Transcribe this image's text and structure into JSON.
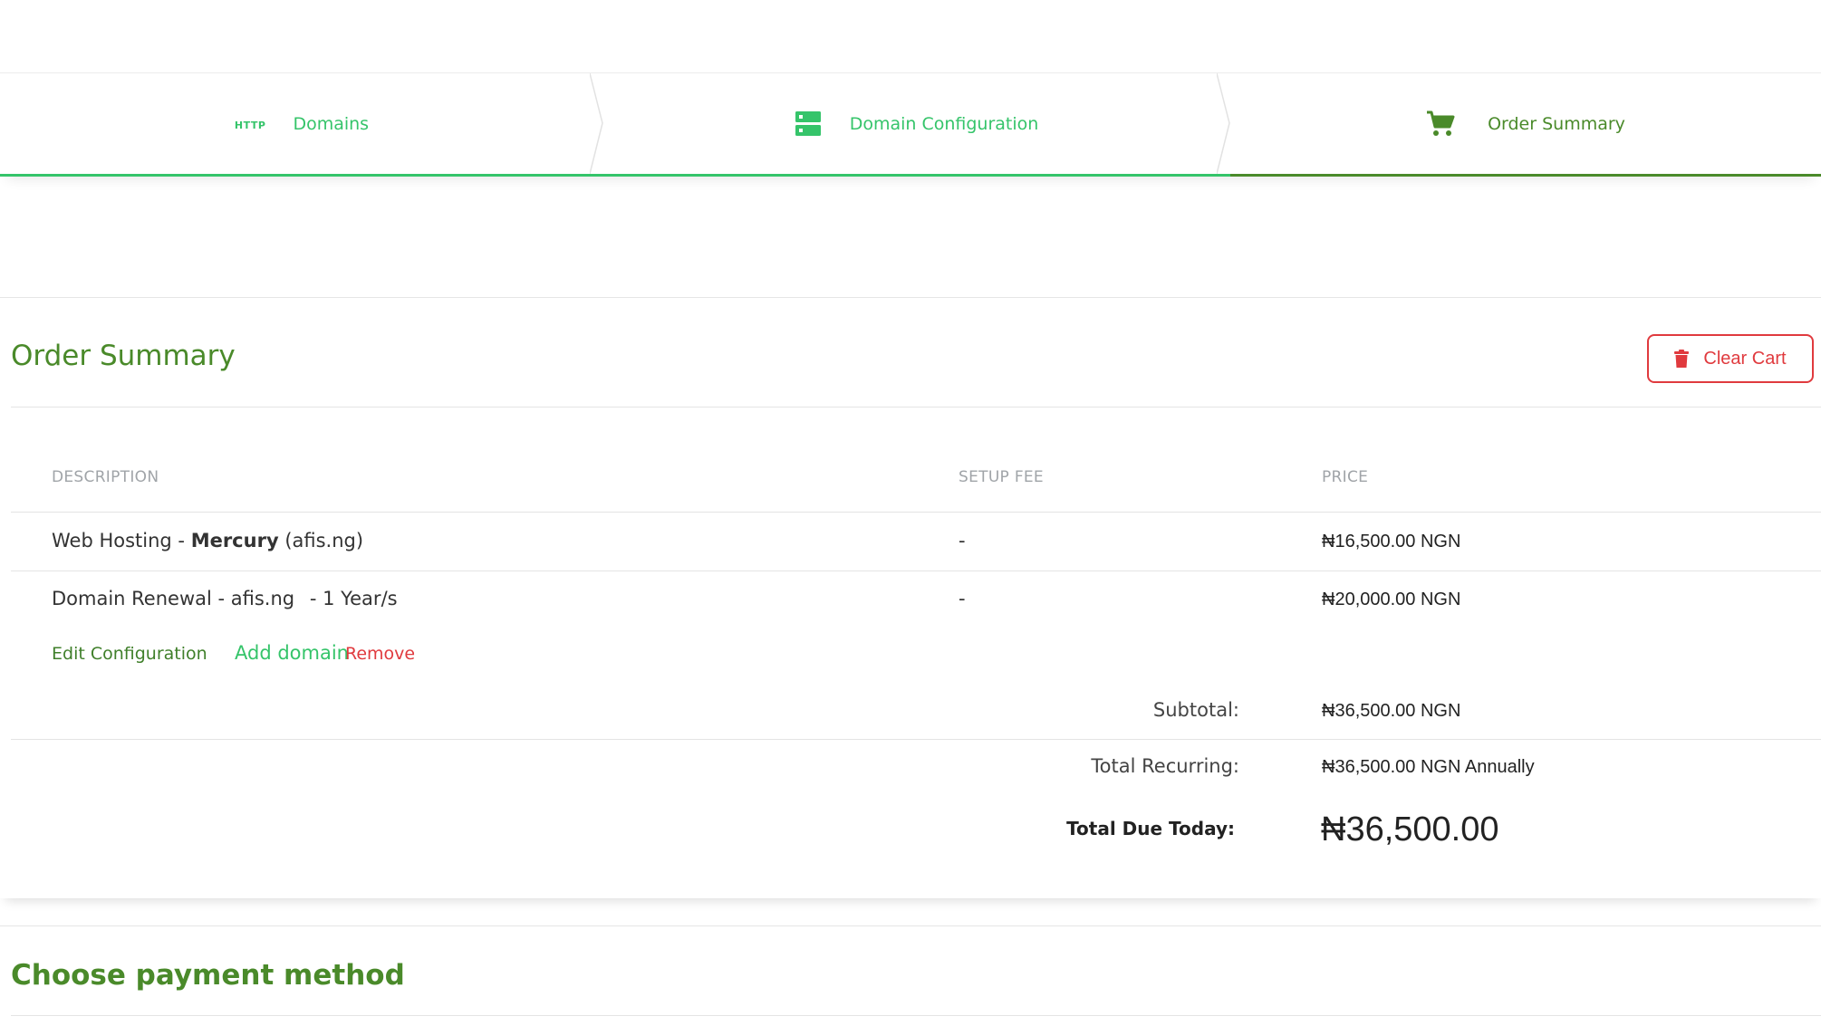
{
  "steps": [
    {
      "label": "Domains",
      "icon": "http-icon"
    },
    {
      "label": "Domain Configuration",
      "icon": "server-icon"
    },
    {
      "label": "Order Summary",
      "icon": "cart-icon"
    }
  ],
  "order_summary": {
    "title": "Order Summary",
    "clear_cart_label": "Clear Cart",
    "columns": {
      "description": "DESCRIPTION",
      "setup_fee": "SETUP FEE",
      "price": "PRICE"
    },
    "items": [
      {
        "prefix": "Web Hosting - ",
        "product": "Mercury",
        "suffix": " (afis.ng)",
        "setup_fee": "-",
        "price": "₦16,500.00 NGN"
      },
      {
        "prefix": "Domain Renewal - afis.ng",
        "period": "- 1 Year/s",
        "setup_fee": "-",
        "price": "₦20,000.00 NGN"
      }
    ],
    "actions": {
      "edit": "Edit Configuration",
      "add_domain": "Add domain",
      "remove": "Remove"
    },
    "subtotal_label": "Subtotal:",
    "subtotal_value": "₦36,500.00 NGN",
    "recurring_label": "Total Recurring:",
    "recurring_value": "₦36,500.00 NGN Annually",
    "due_label": "Total Due Today:",
    "due_value": "₦36,500.00"
  },
  "payment": {
    "title": "Choose payment method"
  },
  "colors": {
    "accent_green": "#35c46a",
    "heading_green": "#4a8a2a",
    "danger_red": "#e03a3e"
  }
}
